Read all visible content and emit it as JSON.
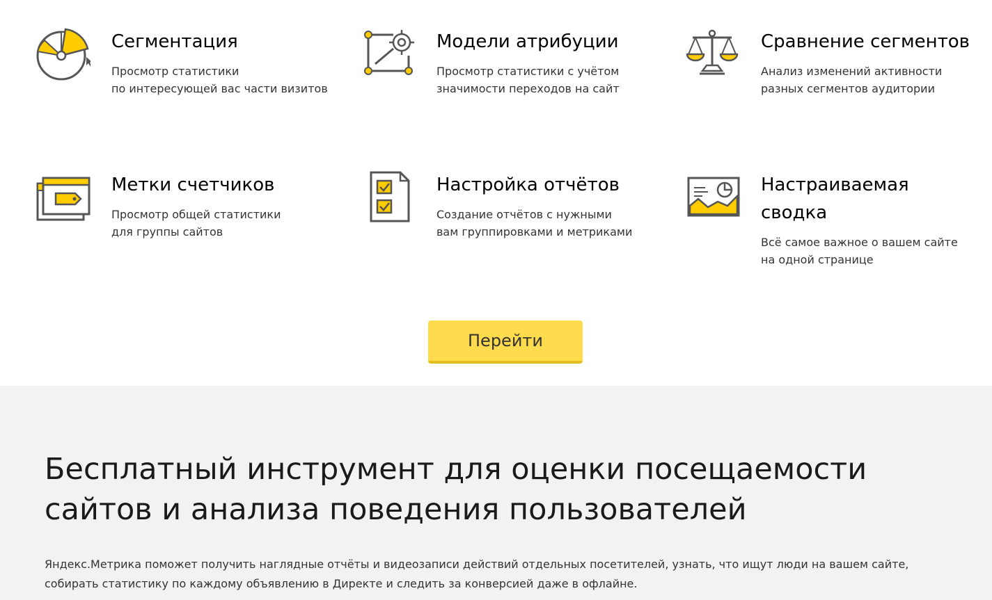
{
  "features": [
    {
      "icon": "segmentation-pie-icon",
      "title": "Сегментация",
      "desc_lines": [
        "Просмотр статистики",
        "по интересующей вас части визитов"
      ]
    },
    {
      "icon": "attribution-target-icon",
      "title": "Модели атрибуции",
      "desc_lines": [
        "Просмотр статистики с учётом",
        "значимости переходов на сайт"
      ]
    },
    {
      "icon": "scales-icon",
      "title": "Сравнение сегментов",
      "desc_lines": [
        "Анализ изменений активности",
        "разных сегментов аудитории"
      ]
    },
    {
      "icon": "counter-tag-icon",
      "title": "Метки счетчиков",
      "desc_lines": [
        "Просмотр общей статистики",
        "для группы сайтов"
      ]
    },
    {
      "icon": "checklist-document-icon",
      "title": "Настройка отчётов",
      "desc_lines": [
        "Создание отчётов с нужными",
        "вам группировками и метриками"
      ]
    },
    {
      "icon": "dashboard-chart-icon",
      "title": "Настраиваемая сводка",
      "desc_lines": [
        "Всё самое важное о вашем сайте",
        "на одной странице"
      ]
    }
  ],
  "go_button_label": "Перейти",
  "about": {
    "headline_lines": [
      "Бесплатный инструмент для оценки посещаемости",
      "сайтов и анализа поведения пользователей"
    ],
    "text_lines": [
      "Яндекс.Метрика поможет получить наглядные отчёты и видеозаписи действий отдельных посетителей, узнать, что ищут люди на вашем сайте,",
      "собирать статистику по каждому объявлению в Директе и следить за конверсией даже в офлайне."
    ]
  },
  "colors": {
    "accent": "#ffdb4d",
    "icon_yellow": "#ffcc00",
    "icon_stroke": "#555555",
    "section_bg": "#f2f2f2"
  }
}
